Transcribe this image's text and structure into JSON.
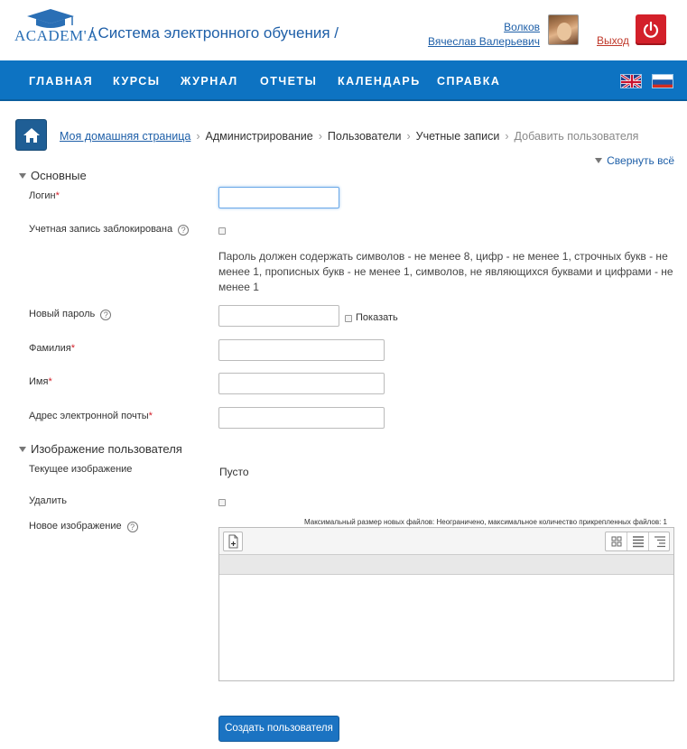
{
  "header": {
    "logo_text": "ACADEM'A",
    "site_title": "/ Система электронного обучения /",
    "user_last_name": "Волков",
    "user_first_names": "Вячеслав Валерьевич",
    "logout_label": "Выход"
  },
  "nav": {
    "items": [
      "ГЛАВНАЯ",
      "КУРСЫ",
      "ЖУРНАЛ",
      "ОТЧЕТЫ",
      "КАЛЕНДАРЬ",
      "СПРАВКА"
    ]
  },
  "breadcrumb": {
    "home": "Моя домашняя страница",
    "items": [
      "Администрирование",
      "Пользователи",
      "Учетные записи"
    ],
    "current": "Добавить пользователя",
    "separator": "›"
  },
  "collapse_all": "Свернуть всё",
  "section_general": {
    "title": "Основные",
    "login_label": "Логин",
    "suspended_label": "Учетная запись заблокирована",
    "password_rules": "Пароль должен содержать символов - не менее 8, цифр - не менее 1, строчных букв - не менее 1, прописных букв - не менее 1, символов, не являющихся буквами и цифрами - не менее 1",
    "new_password_label": "Новый пароль",
    "show_label": "Показать",
    "lastname_label": "Фамилия",
    "firstname_label": "Имя",
    "email_label": "Адрес электронной почты",
    "login_value": "",
    "new_password_value": "",
    "lastname_value": "",
    "firstname_value": "",
    "email_value": ""
  },
  "section_picture": {
    "title": "Изображение пользователя",
    "current_label": "Текущее изображение",
    "current_value": "Пусто",
    "delete_label": "Удалить",
    "new_label": "Новое изображение",
    "max_info": "Максимальный размер новых файлов: Неограничено, максимальное количество прикрепленных файлов: 1"
  },
  "submit_label": "Создать пользователя",
  "colors": {
    "navbar": "#0d73c2",
    "link": "#1e5fa8",
    "logout_button": "#d3202a",
    "required": "#d3202a",
    "submit": "#1b73c2"
  },
  "icons": [
    "graduation-cap-icon",
    "power-icon",
    "uk-flag-icon",
    "ru-flag-icon",
    "home-icon",
    "help-icon",
    "add-file-icon",
    "grid-view-icon",
    "list-view-icon",
    "tree-view-icon"
  ]
}
